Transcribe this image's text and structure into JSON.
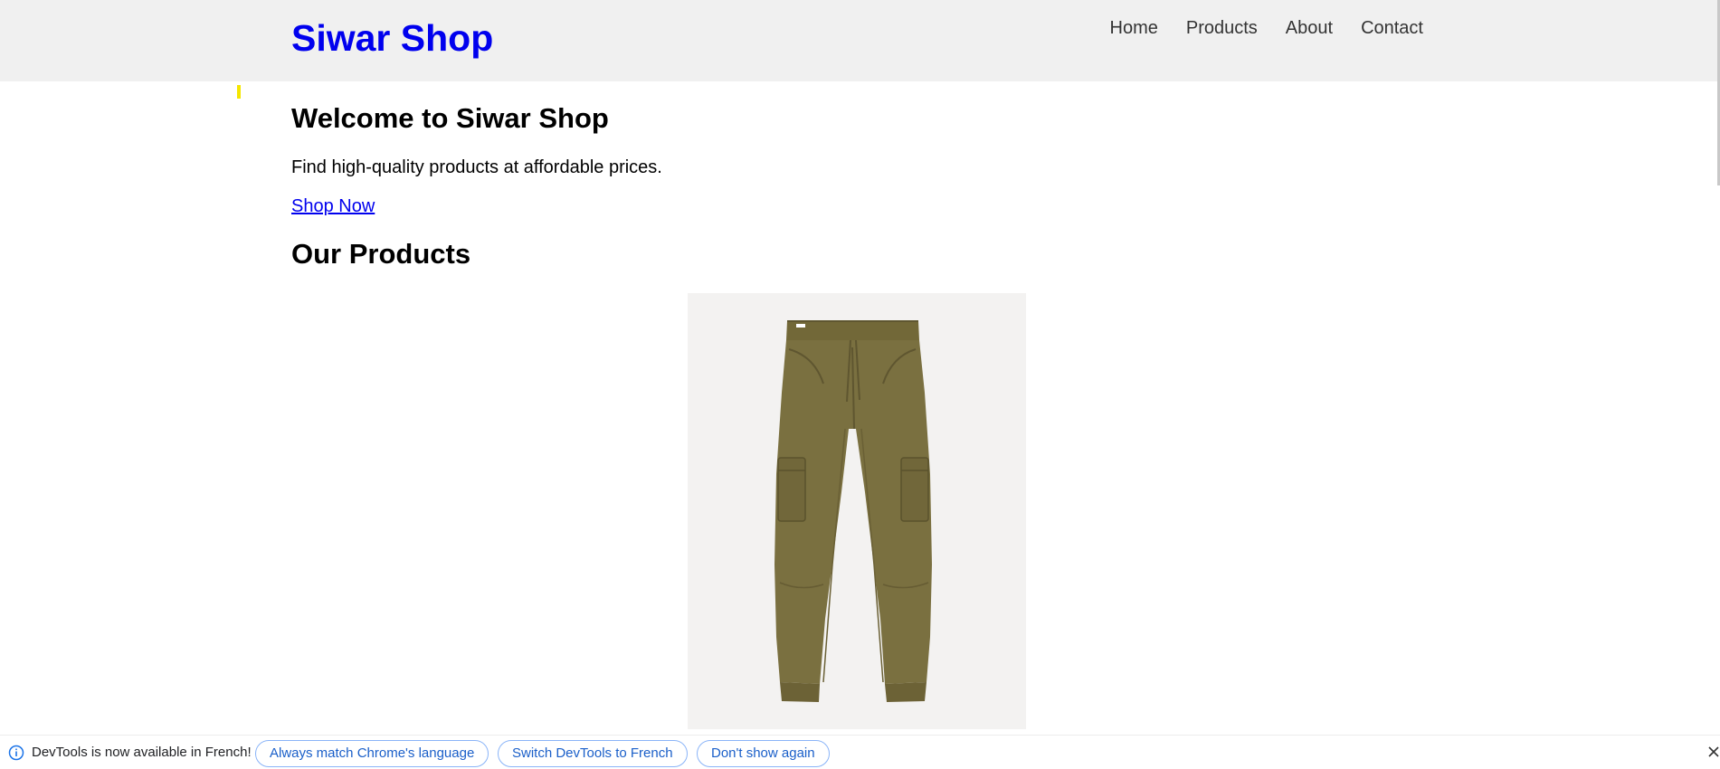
{
  "header": {
    "logo": "Siwar Shop",
    "nav": [
      {
        "label": "Home"
      },
      {
        "label": "Products"
      },
      {
        "label": "About"
      },
      {
        "label": "Contact"
      }
    ]
  },
  "hero": {
    "title": "Welcome to Siwar Shop",
    "text": "Find high-quality products at affordable prices.",
    "cta": "Shop Now"
  },
  "products": {
    "title": "Our Products",
    "items": [
      {
        "image": "olive-cargo-jogger-pants"
      }
    ]
  },
  "devtools_infobar": {
    "message": "DevTools is now available in French!",
    "buttons": [
      {
        "label": "Always match Chrome's language"
      },
      {
        "label": "Switch DevTools to French"
      },
      {
        "label": "Don't show again"
      }
    ],
    "icons": {
      "info": "info-icon",
      "close": "close-icon"
    }
  },
  "colors": {
    "logo": "#0000ee",
    "header_bg": "#f0f0f0",
    "link": "#0000ee",
    "pill_border": "#8ab4f8",
    "pill_text": "#1a5fc9",
    "pants": "#7a7040"
  }
}
